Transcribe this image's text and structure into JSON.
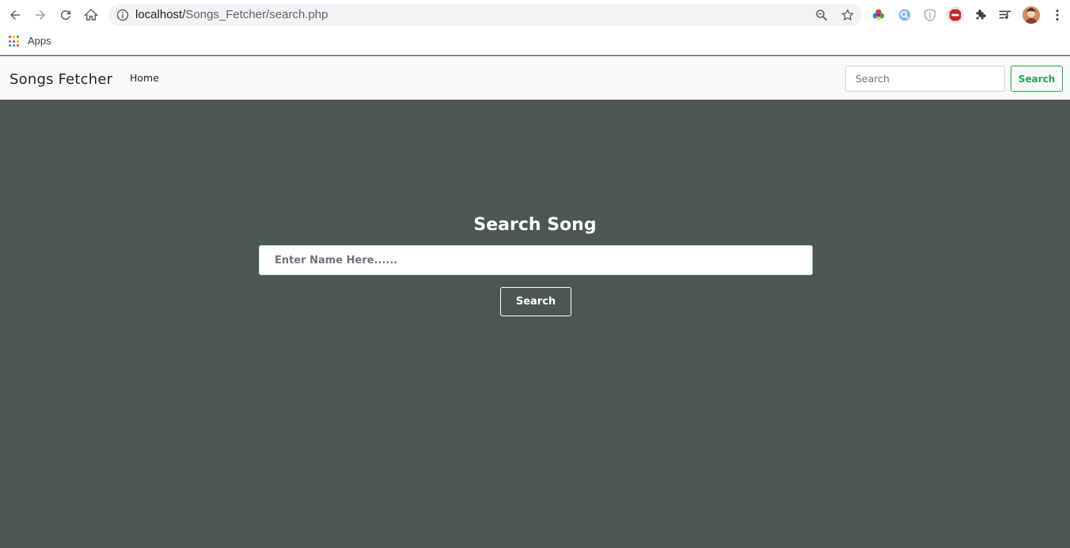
{
  "browser": {
    "url_host": "localhost/",
    "url_path": "Songs_Fetcher/search.php",
    "bookmarks": {
      "apps_label": "Apps"
    }
  },
  "navbar": {
    "brand": "Songs Fetcher",
    "home_link": "Home",
    "search_placeholder": "Search",
    "search_button": "Search"
  },
  "main": {
    "title": "Search Song",
    "input_placeholder": "Enter Name Here......",
    "search_button": "Search"
  },
  "colors": {
    "page_background": "#4b5755",
    "navbar_background": "#f8f9fa",
    "accent_green": "#28a745"
  },
  "icons": [
    "back-icon",
    "forward-icon",
    "reload-icon",
    "home-icon",
    "info-icon",
    "zoom-icon",
    "star-icon",
    "color-wheel-extension-icon",
    "search-extension-icon",
    "shield-extension-icon",
    "adblock-extension-icon",
    "puzzle-icon",
    "media-queue-icon",
    "avatar",
    "more-menu-icon",
    "apps-grid-icon"
  ]
}
